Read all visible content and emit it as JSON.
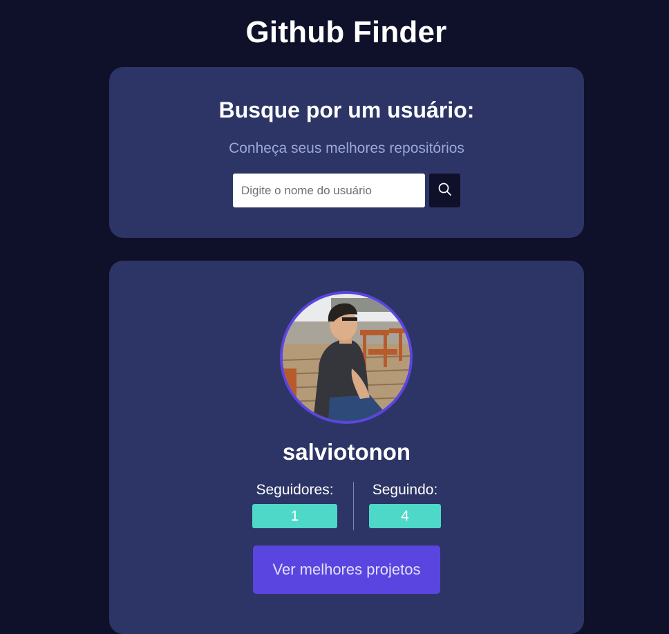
{
  "header": {
    "title": "Github Finder"
  },
  "search": {
    "heading": "Busque por um usuário:",
    "subtitle": "Conheça seus melhores repositórios",
    "placeholder": "Digite o nome do usuário",
    "button_icon": "search-icon"
  },
  "profile": {
    "username": "salviotonon",
    "followers_label": "Seguidores:",
    "followers_count": "1",
    "following_label": "Seguindo:",
    "following_count": "4",
    "projects_button_label": "Ver melhores projetos"
  },
  "colors": {
    "page_background": "#0e1129",
    "card_background": "#2c3565",
    "accent": "#5b45e0",
    "stat_badge": "#4dd8c8",
    "subtitle_text": "#9ca8dc"
  }
}
